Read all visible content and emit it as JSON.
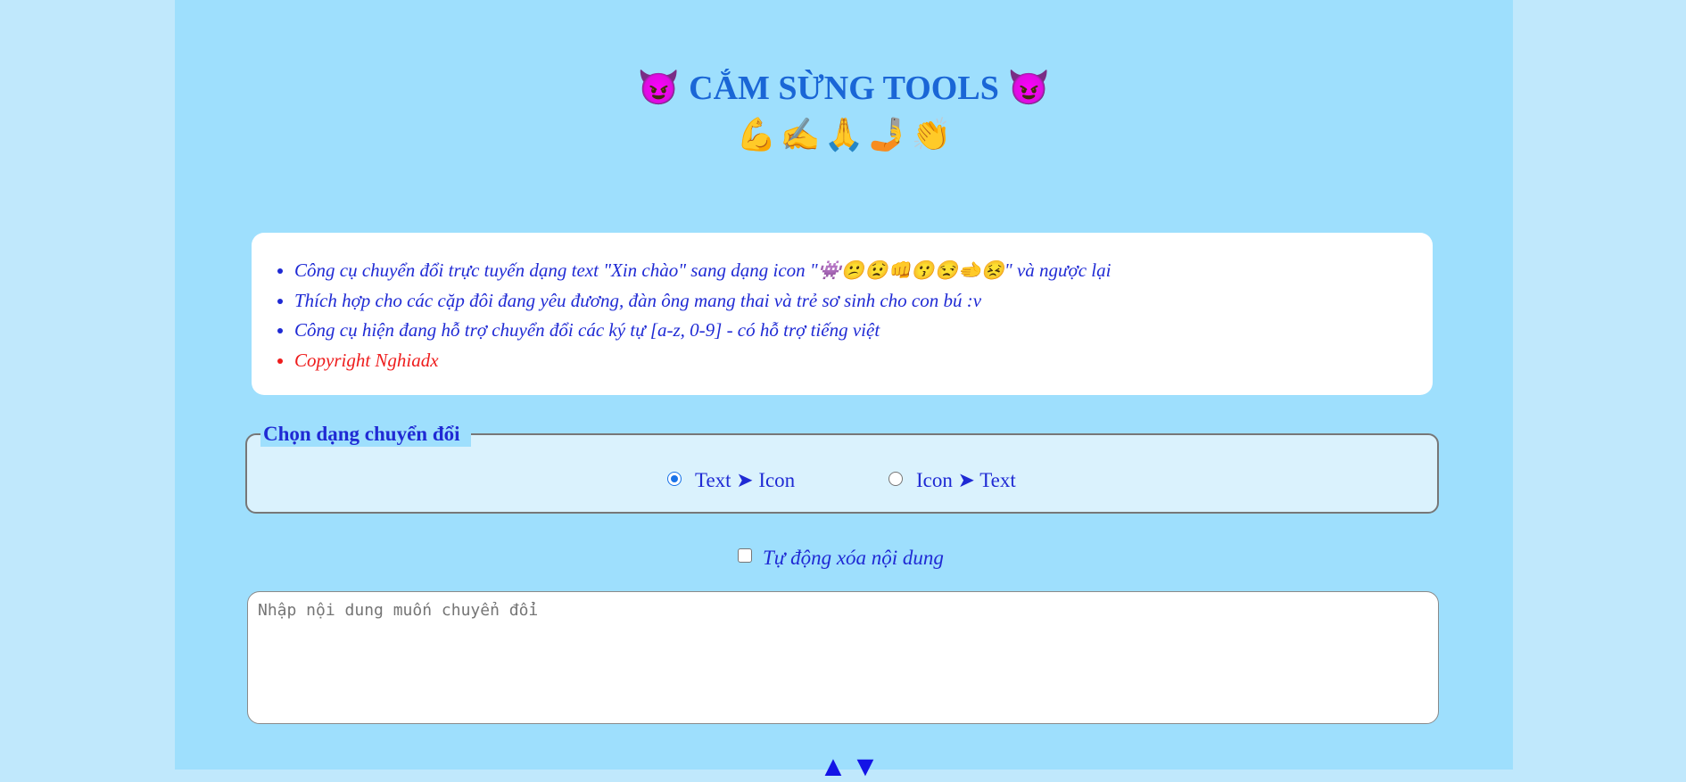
{
  "header": {
    "title": "CẮM SỪNG TOOLS",
    "title_icon_left": "😈",
    "title_icon_right": "😈",
    "emojis": [
      "💪",
      "✍️",
      "🙏",
      "🤳",
      "👏"
    ]
  },
  "info": {
    "items": [
      "Công cụ chuyển đổi trực tuyến dạng text \"Xin chào\" sang dạng icon \"👾😕😟👊😗😒🫲😣\" và ngược lại",
      "Thích hợp cho các cặp đôi đang yêu đương, đàn ông mang thai và trẻ sơ sinh cho con bú :v",
      "Công cụ hiện đang hỗ trợ chuyển đổi các ký tự [a-z, 0-9] - có hỗ trợ tiếng việt",
      "Copyright Nghiadx"
    ]
  },
  "conversion": {
    "legend": "Chọn dạng chuyển đổi",
    "options": [
      {
        "label": "Text ➤ Icon",
        "selected": true
      },
      {
        "label": "Icon ➤ Text",
        "selected": false
      }
    ]
  },
  "auto_clear": {
    "label": "Tự động xóa nội dung",
    "checked": false
  },
  "input": {
    "placeholder": "Nhập nội dung muốn chuyển đổi",
    "value": ""
  },
  "swap": {
    "up": "▲",
    "down": "▼"
  },
  "colors": {
    "page_bg": "#c0e8fc",
    "panel_bg": "#9edffd",
    "title": "#1a66d6",
    "text": "#1f2ad4",
    "copyright": "#ee1c1c"
  }
}
